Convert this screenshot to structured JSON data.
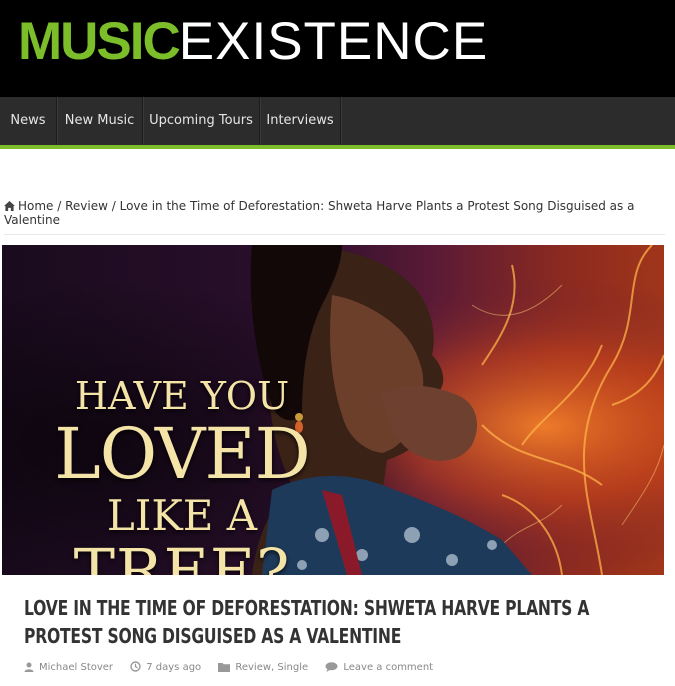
{
  "site": {
    "logo_part1": "MUSIC",
    "logo_part2": "EXISTENCE"
  },
  "nav": {
    "items": [
      {
        "label": "News"
      },
      {
        "label": "New Music"
      },
      {
        "label": "Upcoming Tours"
      },
      {
        "label": "Interviews"
      }
    ]
  },
  "breadcrumb": {
    "home": "Home",
    "sep": " / ",
    "section": "Review",
    "current": "Love in the Time of Deforestation: Shweta Harve Plants a Protest Song Disguised as a Valentine"
  },
  "hero": {
    "line1": "HAVE YOU",
    "line2": "LOVED",
    "line3": "LIKE A",
    "line4": "TREE?"
  },
  "article": {
    "title": "LOVE IN THE TIME OF DEFORESTATION: SHWETA HARVE PLANTS A PROTEST SONG DISGUISED AS A VALENTINE",
    "author": "Michael Stover",
    "date": "7 days ago",
    "category1": "Review",
    "category_sep": ", ",
    "category2": "Single",
    "comments": "Leave a comment"
  },
  "colors": {
    "brand_green": "#7cbd2a",
    "header_bg": "#000000",
    "nav_bg": "#2c2c2c"
  },
  "icons": [
    "home-icon",
    "user-icon",
    "clock-icon",
    "folder-icon",
    "comment-icon"
  ]
}
